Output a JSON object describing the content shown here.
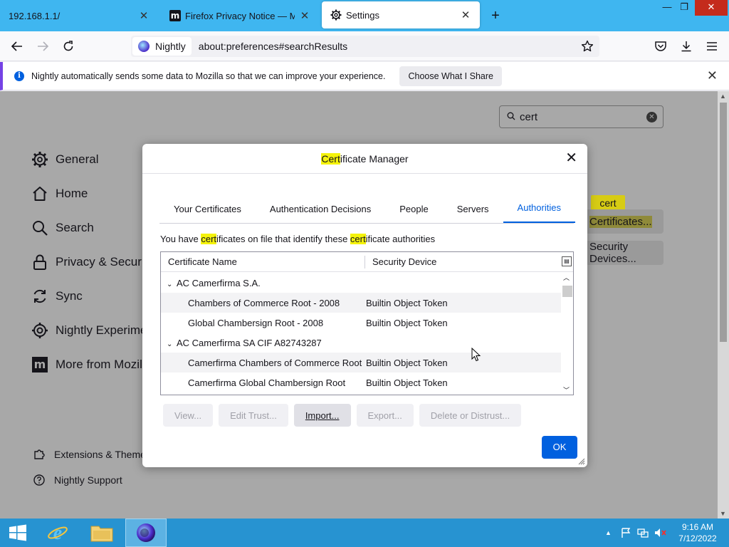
{
  "tabs": [
    {
      "title": "192.168.1.1/",
      "favicon": null
    },
    {
      "title": "Firefox Privacy Notice — Mozilla",
      "favicon": "mozilla-m-icon"
    },
    {
      "title": "Settings",
      "favicon": "gear-icon",
      "active": true
    }
  ],
  "window": {
    "min": "—",
    "max": "❐",
    "close": "✕"
  },
  "navbar": {
    "identity_label": "Nightly",
    "url": "about:preferences#searchResults"
  },
  "notification": {
    "message": "Nightly automatically sends some data to Mozilla so that we can improve your experience.",
    "button": "Choose What I Share"
  },
  "settings": {
    "search_value": "cert",
    "categories": [
      {
        "label": "General",
        "icon": "gear-icon"
      },
      {
        "label": "Home",
        "icon": "home-icon"
      },
      {
        "label": "Search",
        "icon": "search-icon"
      },
      {
        "label": "Privacy & Security",
        "icon": "lock-icon"
      },
      {
        "label": "Sync",
        "icon": "sync-icon"
      },
      {
        "label": "Nightly Experiments",
        "icon": "flask-icon"
      },
      {
        "label": "More from Mozilla",
        "icon": "mozilla-m-icon"
      }
    ],
    "footer_links": [
      {
        "label": "Extensions & Themes",
        "icon": "puzzle-icon"
      },
      {
        "label": "Nightly Support",
        "icon": "help-icon"
      }
    ],
    "tooltip": "cert",
    "certificates_button": "Certificates...",
    "security_devices_button": "Security Devices..."
  },
  "dialog": {
    "title_highlight": "Cert",
    "title_rest": "ificate Manager",
    "tabs": [
      "Your Certificates",
      "Authentication Decisions",
      "People",
      "Servers",
      "Authorities"
    ],
    "active_tab": "Authorities",
    "description": {
      "p1": "You have ",
      "h1": "cert",
      "p2": "ificates on file that identify these ",
      "h2": "cert",
      "p3": "ificate authorities"
    },
    "columns": [
      "Certificate Name",
      "Security Device"
    ],
    "rows": [
      {
        "type": "group",
        "name": "AC Camerfirma S.A.",
        "device": ""
      },
      {
        "type": "child",
        "name": "Chambers of Commerce Root - 2008",
        "device": "Builtin Object Token"
      },
      {
        "type": "child",
        "name": "Global Chambersign Root - 2008",
        "device": "Builtin Object Token"
      },
      {
        "type": "group",
        "name": "AC Camerfirma SA CIF A82743287",
        "device": ""
      },
      {
        "type": "child",
        "name": "Camerfirma Chambers of Commerce Root",
        "device": "Builtin Object Token"
      },
      {
        "type": "child",
        "name": "Camerfirma Global Chambersign Root",
        "device": "Builtin Object Token"
      }
    ],
    "buttons": {
      "view": "View...",
      "edit_trust": "Edit Trust...",
      "import": "Import...",
      "export": "Export...",
      "delete": "Delete or Distrust..."
    },
    "ok": "OK"
  },
  "taskbar": {
    "time": "9:16 AM",
    "date": "7/12/2022"
  },
  "colors": {
    "tabstrip": "#3fb6f0",
    "accent": "#0060df",
    "highlight": "#f5f30b",
    "taskbar": "#2793d1"
  }
}
